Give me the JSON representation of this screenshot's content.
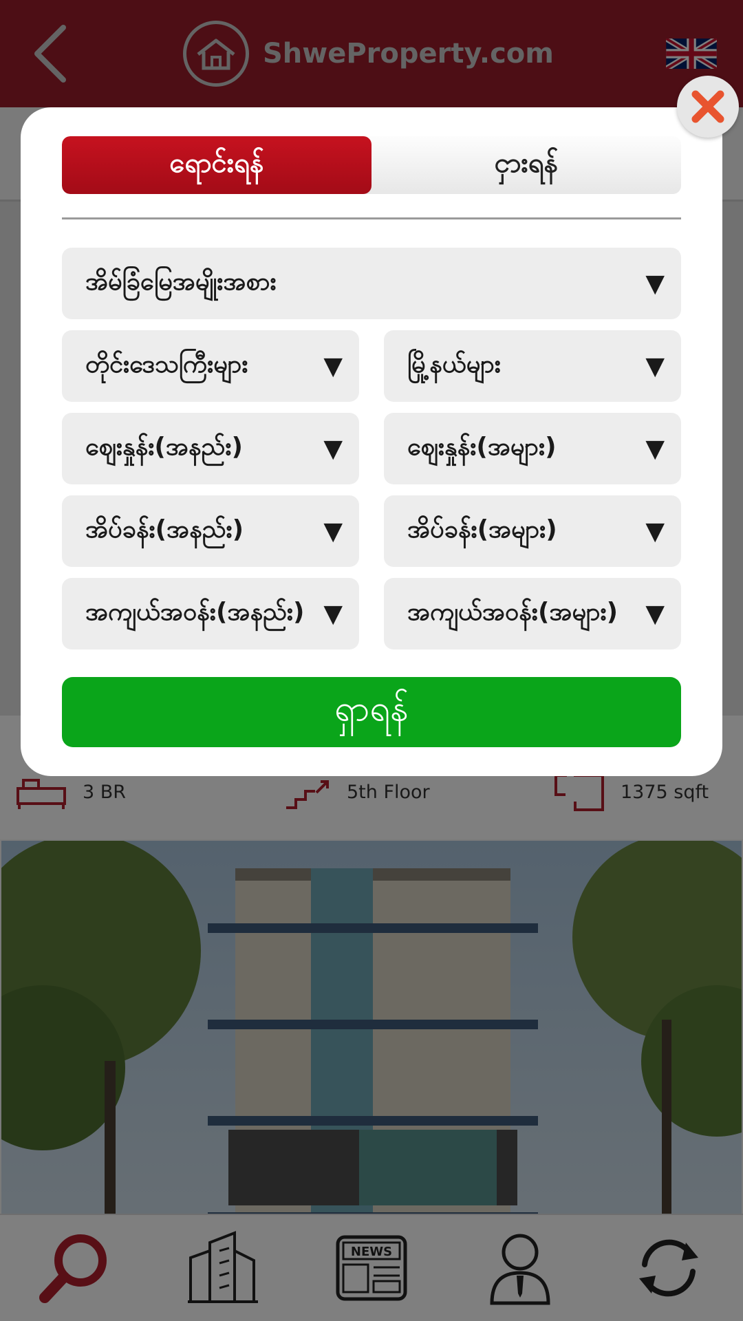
{
  "header": {
    "back_icon": "chevron-left-icon",
    "brand_text": "ShweProperty.com",
    "logo_icon": "house-icon",
    "language_flag": "uk-flag-icon",
    "color": "#9b1c2a"
  },
  "listing": {
    "specs": [
      {
        "icon": "bed-icon",
        "label": "3 BR"
      },
      {
        "icon": "stairs-icon",
        "label": "5th Floor"
      },
      {
        "icon": "area-icon",
        "label": "1375 sqft"
      }
    ]
  },
  "bottom_nav": [
    {
      "icon": "search-icon",
      "active": true
    },
    {
      "icon": "building-icon",
      "active": false
    },
    {
      "icon": "news-icon",
      "active": false
    },
    {
      "icon": "agent-icon",
      "active": false
    },
    {
      "icon": "refresh-icon",
      "active": false
    }
  ],
  "modal": {
    "close_icon": "close-icon",
    "tabs": [
      {
        "label": "ရောင်းရန်",
        "active": true
      },
      {
        "label": "ငှားရန်",
        "active": false
      }
    ],
    "filters": {
      "property_type": "အိမ်ခြံမြေအမျိုးအစား",
      "region": "တိုင်းဒေသကြီးများ",
      "township": "မြို့နယ်များ",
      "price_min": "ဈေးနှုန်း(အနည်း)",
      "price_max": "ဈေးနှုန်း(အများ)",
      "bedroom_min": "အိပ်ခန်း(အနည်း)",
      "bedroom_max": "အိပ်ခန်း(အများ)",
      "area_min": "အကျယ်အဝန်း(အနည်း)",
      "area_max": "အကျယ်အဝန်း(အများ)"
    },
    "dropdown_arrow": "▼",
    "search_label": "ရှာရန်",
    "colors": {
      "active_tab": "#c6121f",
      "search_button": "#0aa51a"
    }
  }
}
